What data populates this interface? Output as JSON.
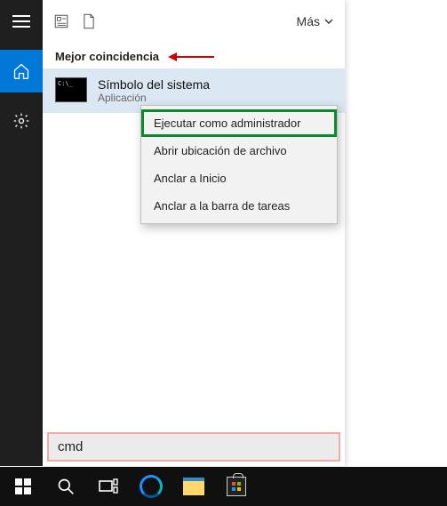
{
  "sidebar": {
    "items": [
      {
        "name": "menu"
      },
      {
        "name": "home"
      },
      {
        "name": "settings"
      }
    ]
  },
  "panel": {
    "more_label": "Más",
    "section_header": "Mejor coincidencia",
    "result": {
      "title": "Símbolo del sistema",
      "subtitle": "Aplicación"
    }
  },
  "context_menu": {
    "items": [
      "Ejecutar como administrador",
      "Abrir ubicación de archivo",
      "Anclar a Inicio",
      "Anclar a la barra de tareas"
    ]
  },
  "search": {
    "value": "cmd"
  },
  "taskbar": {
    "items": [
      "start",
      "search",
      "task-view",
      "edge",
      "file-explorer",
      "store"
    ]
  },
  "annotations": {
    "arrow_color": "#d40000",
    "highlight_color": "#0a8a2f",
    "search_outline_color": "#f3a9a4"
  }
}
